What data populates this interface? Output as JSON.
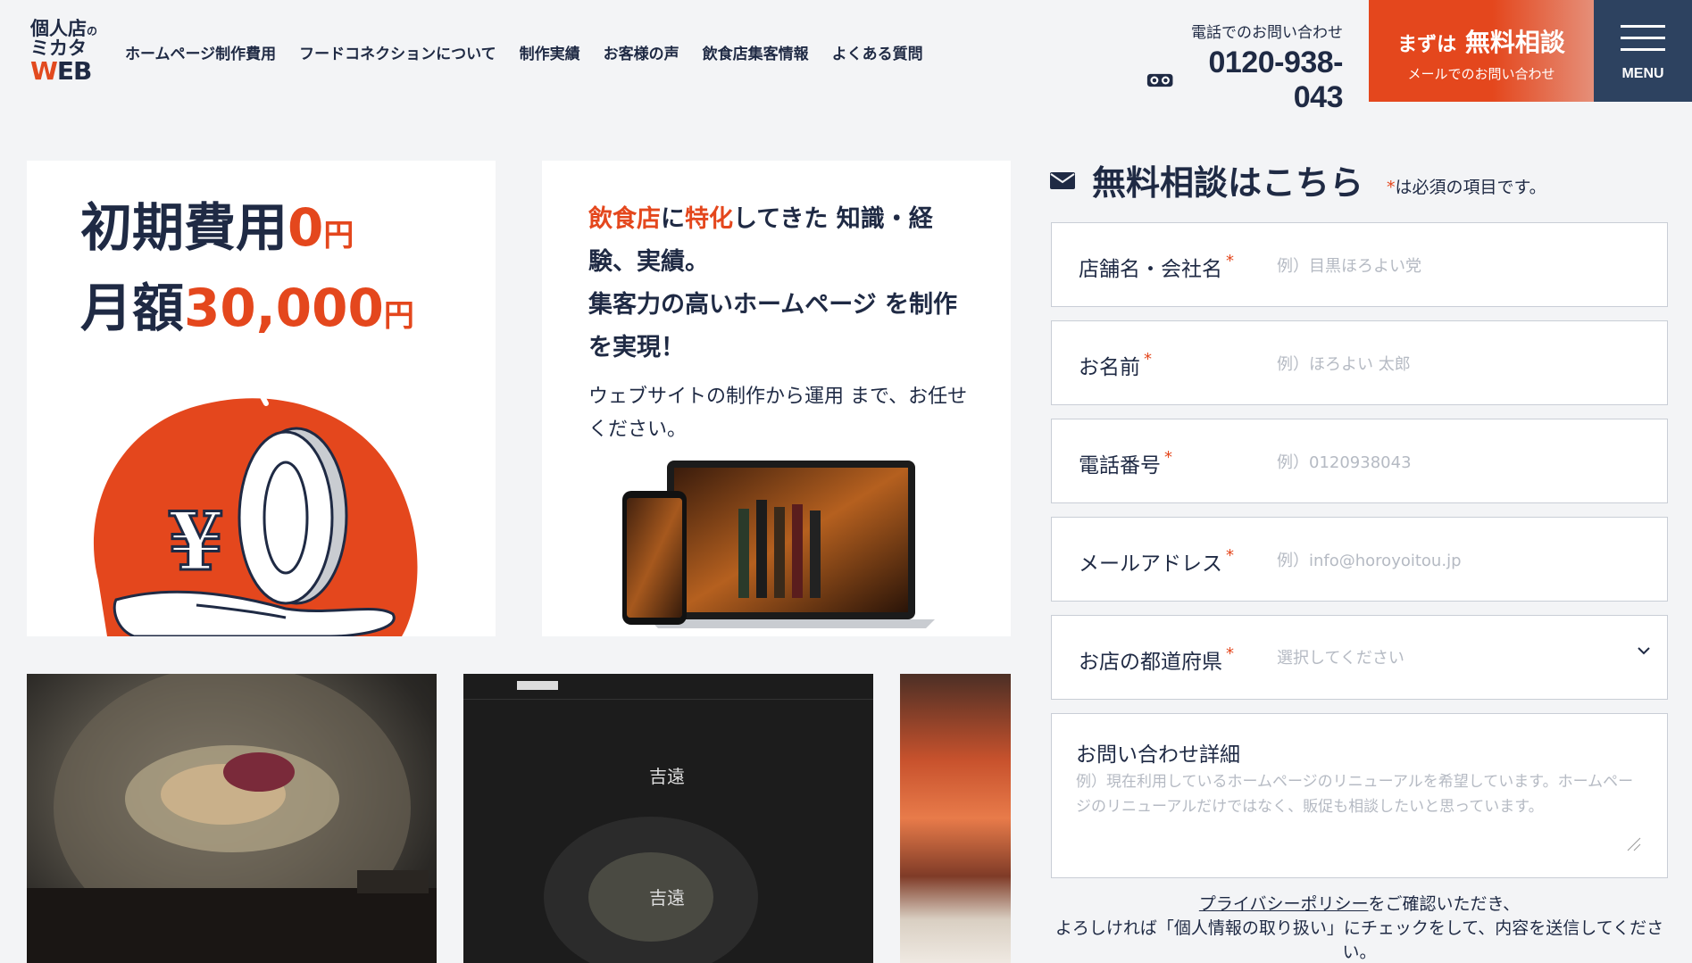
{
  "header": {
    "logo": {
      "line1": "個人店",
      "line1_small": "の",
      "line2": "ミカタ",
      "line3_w": "W",
      "line3_rest": "EB"
    },
    "nav": [
      "ホームページ制作費用",
      "フードコネクションについて",
      "制作実績",
      "お客様の声",
      "飲食店集客情報",
      "よくある質問"
    ],
    "tel_label": "電話でのお問い合わせ",
    "tel_number": "0120-938-043",
    "cta_prefix": "まずは",
    "cta_main": "無料相談",
    "cta_sub": "メールでのお問い合わせ",
    "menu_label": "MENU"
  },
  "card1": {
    "line1_a": "初期費用",
    "line1_num": "0",
    "line1_unit": "円",
    "line2_a": "月額",
    "line2_num": "30,000",
    "line2_unit": "円",
    "illustration_yen": "¥",
    "illustration_zero": "0"
  },
  "card2": {
    "h_a": "飲食店",
    "h_b": "に",
    "h_c": "特化",
    "h_d": "してきた 知識・経験、実績。",
    "h_e": "集客力の高いホームページ を制作を実現！",
    "desc": "ウェブサイトの制作から運用 まで、お任せください。"
  },
  "form": {
    "title": "無料相談はこちら",
    "note_star": "*",
    "note": "は必須の項目です。",
    "required_mark": "*",
    "fields": [
      {
        "label": "店舗名・会社名",
        "placeholder": "例）目黒ほろよい党"
      },
      {
        "label": "お名前",
        "placeholder": "例）ほろよい 太郎"
      },
      {
        "label": "電話番号",
        "placeholder": "例）0120938043"
      },
      {
        "label": "メールアドレス",
        "placeholder": "例）info@horoyoitou.jp"
      }
    ],
    "prefecture": {
      "label": "お店の都道府県",
      "placeholder": "選択してください"
    },
    "details": {
      "label": "お問い合わせ詳細",
      "placeholder": "例）現在利用しているホームページのリニューアルを希望しています。ホームページのリニューアルだけではなく、販促も相談したいと思っています。"
    },
    "privacy_link": "プライバシーポリシー",
    "privacy_text1": "をご確認いただき、",
    "privacy_text2": "よろしければ「個人情報の取り扱い」にチェックをして、内容を送信してください。"
  },
  "colors": {
    "accent": "#e4471d",
    "navy": "#1f2a44",
    "menu_bg": "#2d4260",
    "bg": "#f3f4f6"
  },
  "icons": [
    "phone-freedial-icon",
    "mail-icon",
    "menu-icon",
    "chevron-down-icon",
    "resize-handle-icon"
  ]
}
